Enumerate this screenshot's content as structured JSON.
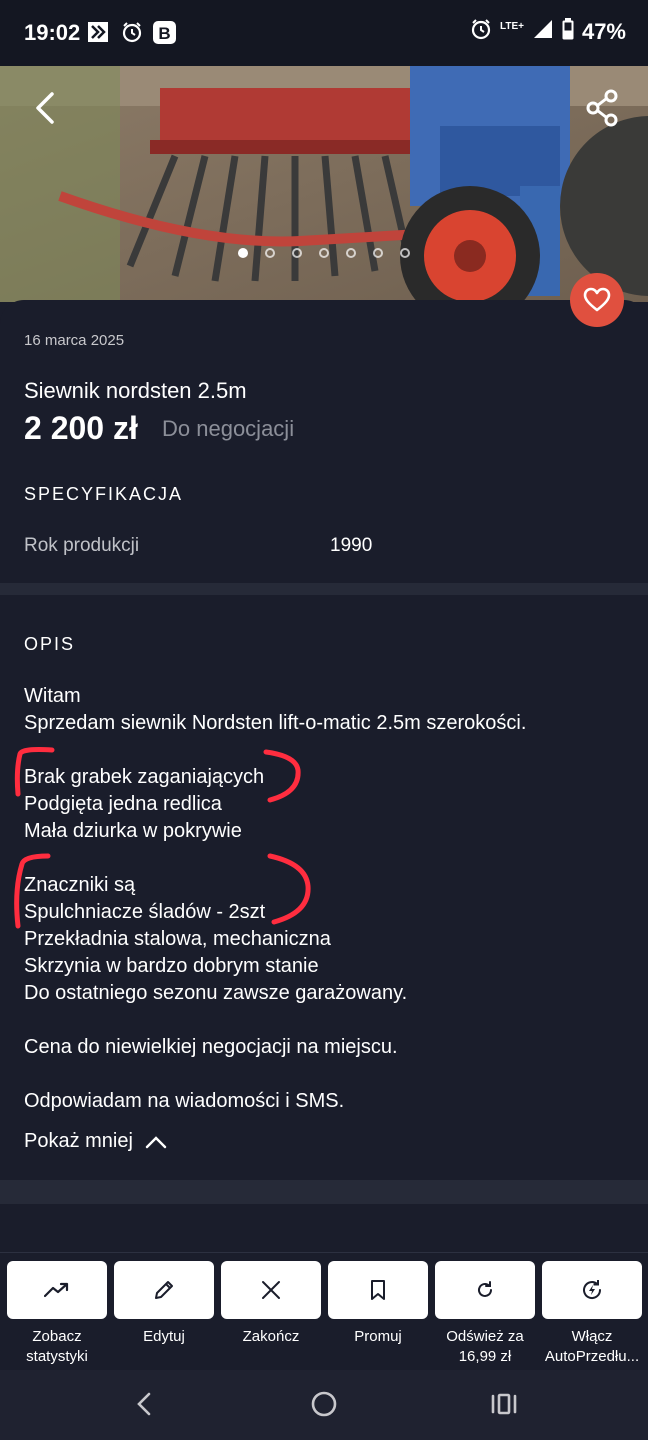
{
  "status_bar": {
    "time": "19:02",
    "network": "LTE+",
    "battery": "47%"
  },
  "gallery": {
    "photo_count": 7,
    "active_index": 0
  },
  "listing": {
    "date": "16 marca 2025",
    "title": "Siewnik nordsten 2.5m",
    "price": "2 200 zł",
    "negotiable": "Do negocjacji"
  },
  "specs": {
    "heading": "SPECYFIKACJA",
    "rows": [
      {
        "label": "Rok produkcji",
        "value": "1990"
      }
    ]
  },
  "description": {
    "heading": "OPIS",
    "text": "Witam\nSprzedam siewnik Nordsten lift-o-matic 2.5m szerokości.\n\nBrak grabek zaganiających\nPodgięta jedna redlica\nMała dziurka w pokrywie\n\nZnaczniki są\nSpulchniacze śladów - 2szt\nPrzekładnia stalowa, mechaniczna\nSkrzynia w bardzo dobrym stanie\nDo ostatniego sezonu zawsze garażowany.\n\nCena do niewielkiej negocjacji na miejscu.\n\nOdpowiadam na wiadomości i SMS.",
    "toggle": "Pokaż mniej"
  },
  "actions": [
    {
      "label": "Zobacz statystyki",
      "icon": "trending-up-icon"
    },
    {
      "label": "Edytuj",
      "icon": "pencil-icon"
    },
    {
      "label": "Zakończ",
      "icon": "close-icon"
    },
    {
      "label": "Promuj",
      "icon": "bookmark-icon"
    },
    {
      "label": "Odśwież za 16,99 zł",
      "icon": "refresh-icon"
    },
    {
      "label": "Włącz AutoPrzedłu...",
      "icon": "auto-renew-icon"
    }
  ],
  "colors": {
    "background": "#1a1d2b",
    "favorite": "#e0503f",
    "action_button": "#ffffff",
    "annotation": "#ff2d3f"
  }
}
